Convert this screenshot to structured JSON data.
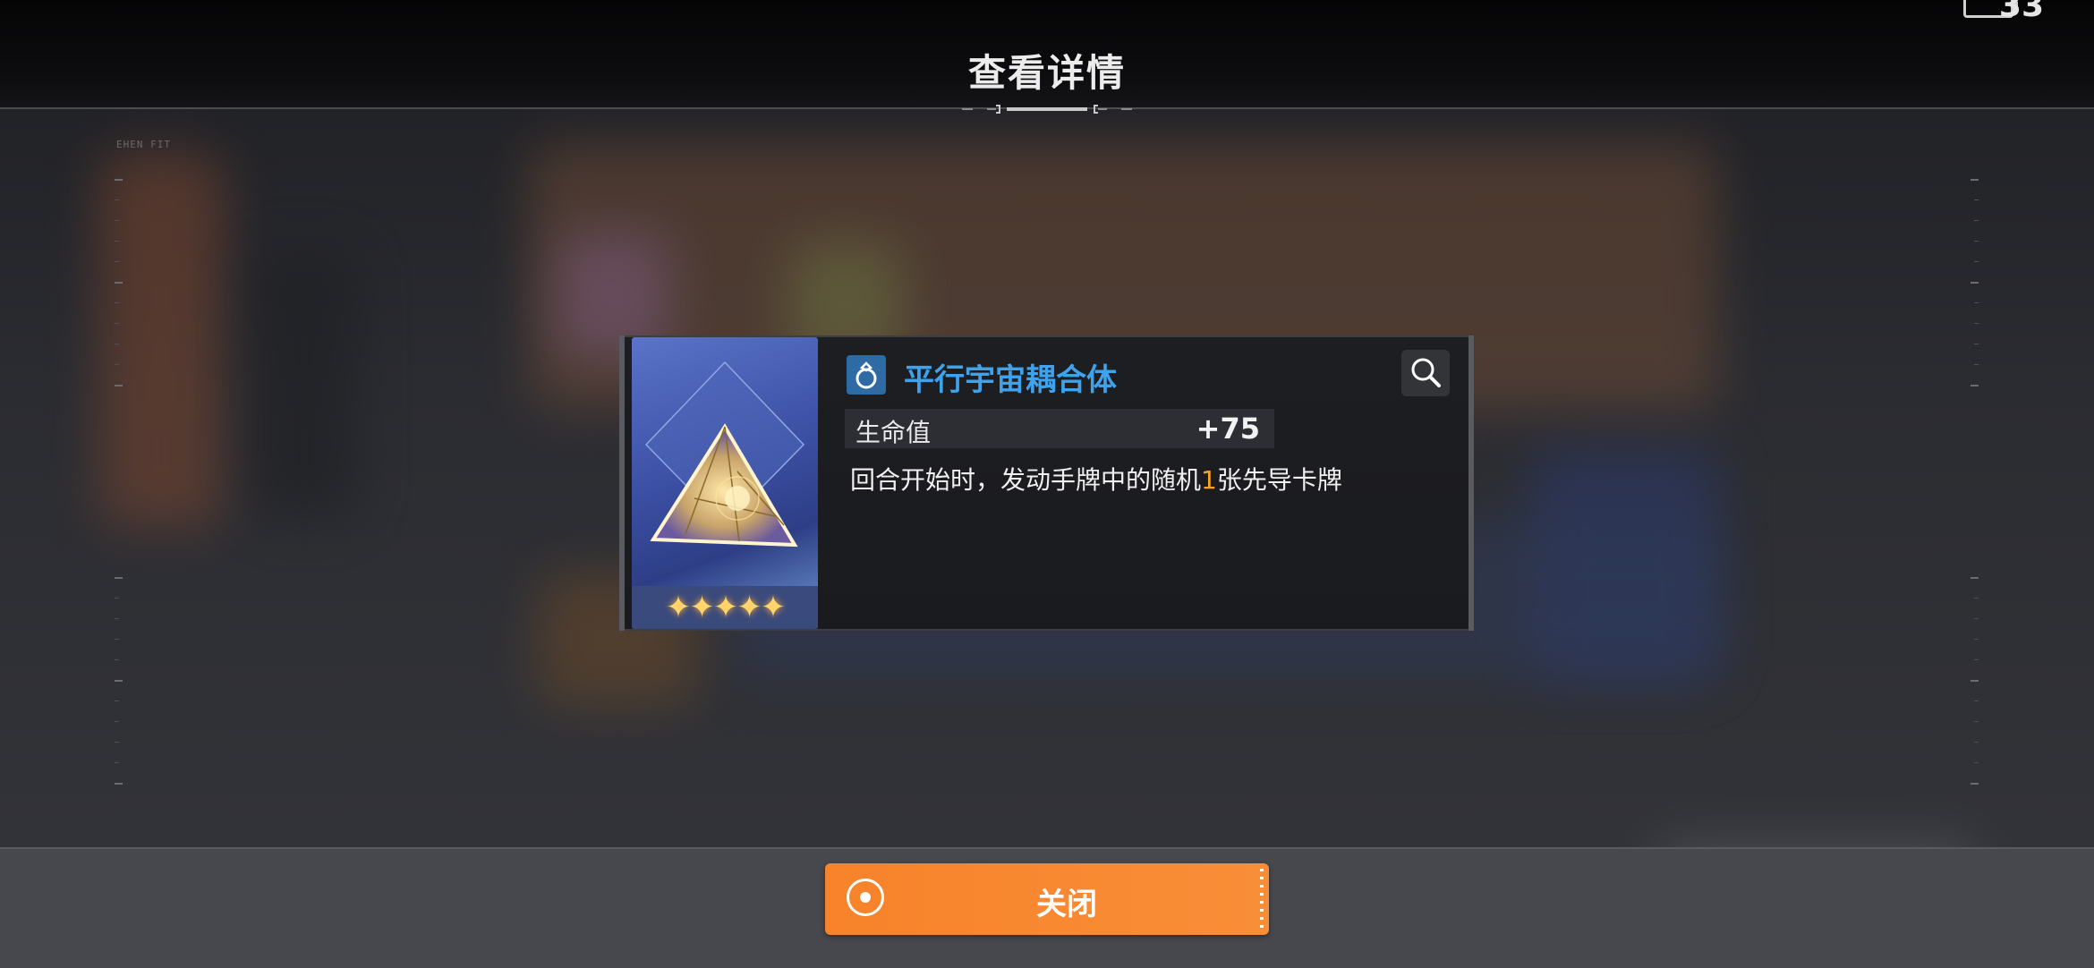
{
  "header": {
    "title": "查看详情",
    "battery": "33"
  },
  "background": {
    "frame_label": "EHEN FIT"
  },
  "item": {
    "name": "平行宇宙耦合体",
    "rarity_stars": 5,
    "stars_text": "✦✦✦✦✦",
    "stat": {
      "label": "生命值",
      "value": "+75"
    },
    "description": {
      "before": "回合开始时，发动手牌中的随机",
      "highlight": "1",
      "after": "张先导卡牌"
    }
  },
  "footer": {
    "close_label": "关闭"
  },
  "colors": {
    "accent_orange": "#f7832a",
    "name_blue": "#3ea2ec",
    "highlight": "#f6a623"
  }
}
